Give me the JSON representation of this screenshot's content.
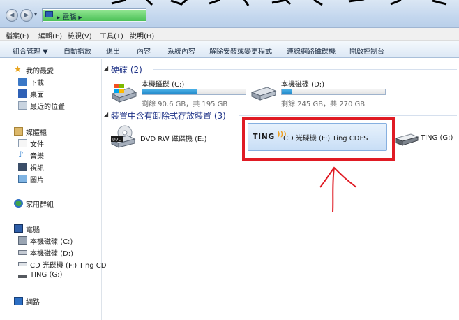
{
  "address": {
    "segments": [
      "電腦"
    ]
  },
  "menu": [
    "檔案(F)",
    "編輯(E)",
    "檢視(V)",
    "工具(T)",
    "說明(H)"
  ],
  "toolbar": [
    "組合管理 ▼",
    "自動播放",
    "退出",
    "內容",
    "系統內容",
    "解除安裝或變更程式",
    "連線網路磁碟機",
    "開啟控制台"
  ],
  "nav": {
    "favorites": {
      "label": "我的最愛",
      "items": [
        "下載",
        "桌面",
        "最近的位置"
      ]
    },
    "libraries": {
      "label": "媒體櫃",
      "items": [
        "文件",
        "音樂",
        "視訊",
        "圖片"
      ]
    },
    "homegroup": "家用群組",
    "computer": {
      "label": "電腦",
      "items": [
        "本機磁碟 (C:)",
        "本機磁碟 (D:)",
        "CD 光碟機 (F:) Ting CD",
        "TING (G:)"
      ]
    },
    "network": "網路"
  },
  "groups": {
    "hard_disks": "硬碟 (2)",
    "removable": "裝置中含有卸除式存放裝置 (3)"
  },
  "drives": {
    "c": {
      "name": "本機磁碟 (C:)",
      "free": "剩餘 90.6 GB，共 195 GB",
      "used_fraction": 0.535
    },
    "d": {
      "name": "本機磁碟 (D:)",
      "free": "剩餘 245 GB，共 270 GB",
      "used_fraction": 0.093
    },
    "e": {
      "name": "DVD RW 磁碟機 (E:)"
    },
    "f": {
      "name": "CD 光碟機 (F:) Ting CDFS",
      "logo": "TING"
    },
    "g": {
      "name": "TING (G:)"
    }
  },
  "colors": {
    "highlight": "#e01b24",
    "accent": "#1f86c8"
  }
}
